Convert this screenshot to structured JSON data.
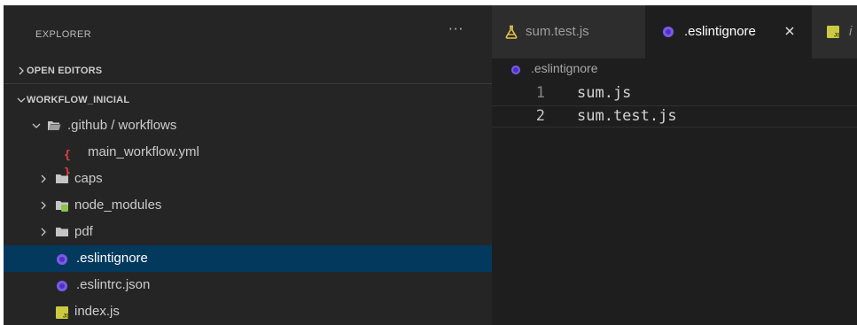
{
  "sidebar": {
    "title": "EXPLORER",
    "more_actions": "···",
    "sections": {
      "open_editors": "OPEN EDITORS",
      "workspace": "WORKFLOW_INICIAL"
    },
    "tree": [
      {
        "name": ".github / workflows",
        "type": "folder",
        "expanded": true
      },
      {
        "name": "main_workflow.yml",
        "type": "yaml"
      },
      {
        "name": "caps",
        "type": "folder",
        "expanded": false
      },
      {
        "name": "node_modules",
        "type": "node-folder",
        "expanded": false
      },
      {
        "name": "pdf",
        "type": "folder",
        "expanded": false
      },
      {
        "name": ".eslintignore",
        "type": "eslint",
        "selected": true
      },
      {
        "name": ".eslintrc.json",
        "type": "eslint"
      },
      {
        "name": "index.js",
        "type": "js"
      }
    ]
  },
  "editor": {
    "tabs": [
      {
        "label": "sum.test.js",
        "icon": "flask-icon",
        "active": false
      },
      {
        "label": ".eslintignore",
        "icon": "eslint-icon",
        "active": true,
        "close": "×"
      },
      {
        "label": "i",
        "icon": "js-icon",
        "active": false
      }
    ],
    "breadcrumb": ".eslintignore",
    "lines": [
      {
        "number": "1",
        "text": "sum.js"
      },
      {
        "number": "2",
        "text": "sum.test.js"
      }
    ]
  },
  "colors": {
    "selection": "#04395e",
    "eslint": "#4b32c3",
    "js_badge": "#cbcb41",
    "yaml": "#e04040",
    "folder": "#c5c5c5",
    "node_folder": "#8bc34a",
    "flask": "#e7c547"
  }
}
